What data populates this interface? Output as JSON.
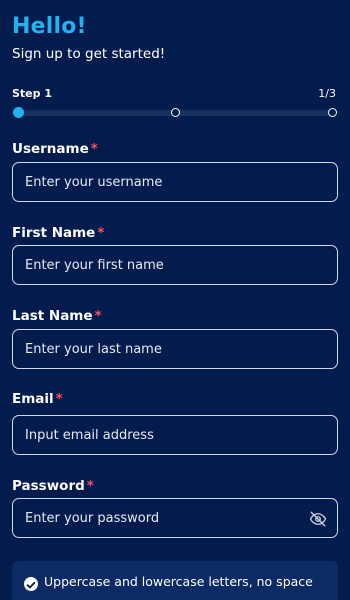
{
  "header": {
    "title": "Hello!",
    "subtitle": "Sign up to get started!"
  },
  "stepper": {
    "label": "Step 1",
    "count": "1/3",
    "current_step": 1,
    "total_steps": 3
  },
  "form": {
    "required_marker": "*",
    "username": {
      "label": "Username",
      "placeholder": "Enter your username"
    },
    "first_name": {
      "label": "First Name",
      "placeholder": "Enter your first name"
    },
    "last_name": {
      "label": "Last Name",
      "placeholder": "Enter your last name"
    },
    "email": {
      "label": "Email",
      "placeholder": "Input email address"
    },
    "password": {
      "label": "Password",
      "placeholder": "Enter your password",
      "toggle_icon": "eye-off-icon"
    }
  },
  "password_rules": [
    {
      "text": "Uppercase and lowercase letters, no space",
      "icon": "check-circle-icon",
      "satisfied": true
    }
  ],
  "colors": {
    "background": "#041b4d",
    "accent": "#1fb3f0",
    "required": "#ff4d5e"
  }
}
